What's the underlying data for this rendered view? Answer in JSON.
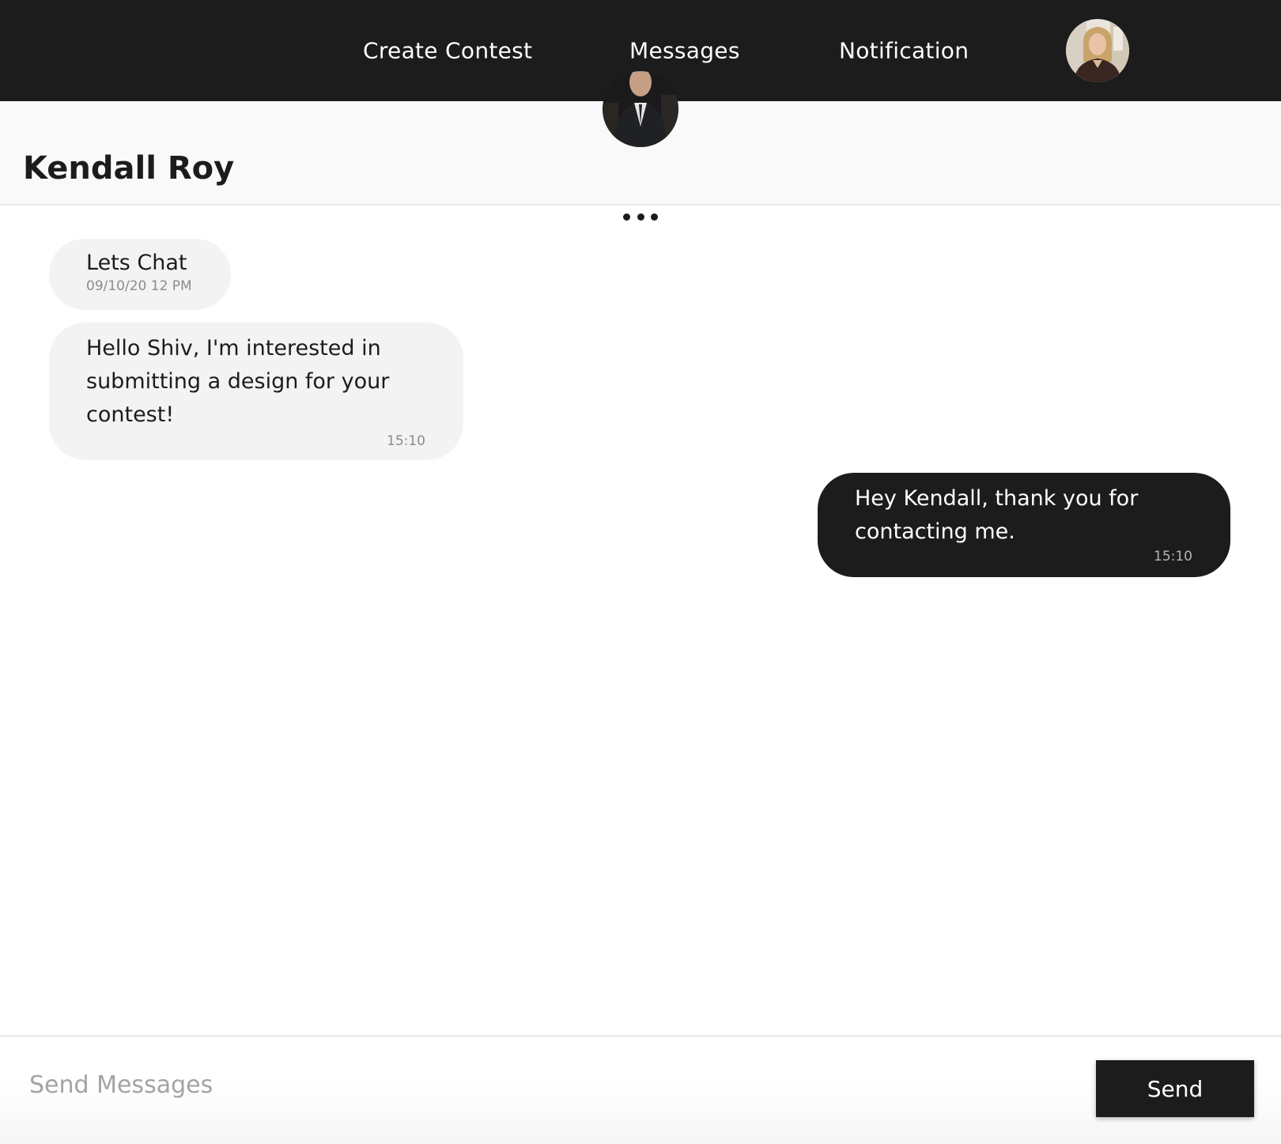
{
  "nav": {
    "create_contest": "Create Contest",
    "messages": "Messages",
    "notification": "Notification"
  },
  "chat": {
    "contact_name": "Kendall Roy",
    "messages": [
      {
        "direction": "incoming",
        "text": "Lets Chat",
        "meta": "09/10/20 12 PM"
      },
      {
        "direction": "incoming",
        "text": "Hello Shiv, I'm interested in submitting a design for your contest!",
        "time": "15:10"
      },
      {
        "direction": "outgoing",
        "text": "Hey Kendall, thank you for contacting me.",
        "time": "15:10"
      }
    ]
  },
  "composer": {
    "placeholder": "Send Messages",
    "send_label": "Send"
  },
  "colors": {
    "topbar": "#1c1c1c",
    "incoming_bubble": "#f3f3f3",
    "outgoing_bubble": "#1c1c1c",
    "accent": "#1c1c1c"
  },
  "icons": {
    "more": "more-horizontal-icon"
  }
}
